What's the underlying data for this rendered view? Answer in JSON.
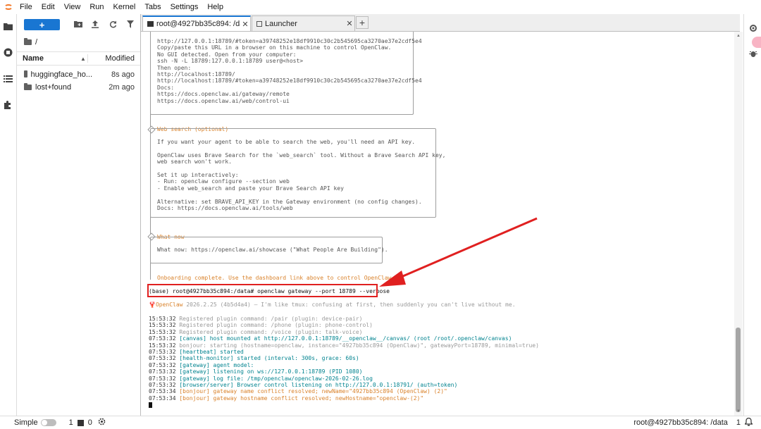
{
  "menu": [
    "File",
    "Edit",
    "View",
    "Run",
    "Kernel",
    "Tabs",
    "Settings",
    "Help"
  ],
  "filebrowser": {
    "new_label": "+",
    "breadcrumb": "/",
    "col_name": "Name",
    "col_modified": "Modified",
    "items": [
      {
        "name": "huggingface_ho...",
        "modified": "8s ago"
      },
      {
        "name": "lost+found",
        "modified": "2m ago"
      }
    ]
  },
  "tabs": {
    "terminal": "root@4927bb35c894: /dat",
    "launcher": "Launcher",
    "close": "✕",
    "add": "+"
  },
  "terminal": {
    "block1": [
      "http://127.0.0.1:18789/#token=a39748252e18df9910c30c2b545695ca3270ae37e2cdf5e4",
      "Copy/paste this URL in a browser on this machine to control OpenClaw.",
      "No GUI detected. Open from your computer:",
      "ssh -N -L 18789:127.0.0.1:18789 user@<host>",
      "Then open:",
      "http://localhost:18789/",
      "http://localhost:18789/#token=a39748252e18df9910c30c2b545695ca3270ae37e2cdf5e4",
      "Docs:",
      "https://docs.openclaw.ai/gateway/remote",
      "https://docs.openclaw.ai/web/control-ui"
    ],
    "websearch_title": "Web search (optional)",
    "websearch": [
      "If you want your agent to be able to search the web, you'll need an API key.",
      "",
      "OpenClaw uses Brave Search for the `web_search` tool. Without a Brave Search API key,",
      "web search won't work.",
      "",
      "Set it up interactively:",
      "- Run: openclaw configure --section web",
      "- Enable web_search and paste your Brave Search API key",
      "",
      "Alternative: set BRAVE_API_KEY in the Gateway environment (no config changes).",
      "Docs: https://docs.openclaw.ai/tools/web"
    ],
    "whatnow_title": "What now",
    "whatnow": "What now: https://openclaw.ai/showcase (\"What People Are Building\").",
    "onboarding": "Onboarding complete. Use the dashboard link above to control OpenClaw.",
    "command": "(base) root@4927bb35c894:/data# openclaw gateway --port 18789 --verbose",
    "banner_name": "OpenClaw",
    "banner_rest": " 2026.2.25 (4b5d4a4) — I'm like tmux: confusing at first, then suddenly you can't live without me.",
    "logs": [
      {
        "time": "15:53:32",
        "tag": "",
        "text": "Registered plugin command: /pair (plugin: device-pair)",
        "color": "grey"
      },
      {
        "time": "15:53:32",
        "tag": "",
        "text": "Registered plugin command: /phone (plugin: phone-control)",
        "color": "grey"
      },
      {
        "time": "15:53:32",
        "tag": "",
        "text": "Registered plugin command: /voice (plugin: talk-voice)",
        "color": "grey"
      },
      {
        "time": "07:53:32",
        "tag": "[canvas]",
        "text": "host mounted at http://127.0.0.1:18789/__openclaw__/canvas/ (root /root/.openclaw/canvas)",
        "color": "teal"
      },
      {
        "time": "15:53:32",
        "tag": "",
        "text": "bonjour: starting (hostname=openclaw, instance=\"4927bb35c894 (OpenClaw)\", gatewayPort=18789, minimal=true)",
        "color": "grey"
      },
      {
        "time": "07:53:32",
        "tag": "[heartbeat]",
        "text": "started",
        "color": "teal"
      },
      {
        "time": "07:53:32",
        "tag": "[health-monitor]",
        "text": "started (interval: 300s, grace: 60s)",
        "color": "teal"
      },
      {
        "time": "07:53:32",
        "tag": "[gateway]",
        "text": "agent model:",
        "color": "teal"
      },
      {
        "time": "07:53:32",
        "tag": "[gateway]",
        "text": "listening on ws://127.0.0.1:18789 (PID 1080)",
        "color": "teal"
      },
      {
        "time": "07:53:32",
        "tag": "[gateway]",
        "text": "log file: /tmp/openclaw/openclaw-2026-02-26.log",
        "color": "teal"
      },
      {
        "time": "07:53:32",
        "tag": "[browser/server]",
        "text": "Browser control listening on http://127.0.0.1:18791/ (auth=token)",
        "color": "teal"
      },
      {
        "time": "07:53:34",
        "tag": "[bonjour]",
        "text": "gateway name conflict resolved; newName=\"4927bb35c894 (OpenClaw) (2)\"",
        "color": "orange"
      },
      {
        "time": "07:53:34",
        "tag": "[bonjour]",
        "text": "gateway hostname conflict resolved; newHostname=\"openclaw-(2)\"",
        "color": "orange"
      }
    ]
  },
  "status": {
    "simple": "Simple",
    "count1": "1",
    "count2": "0",
    "terminal_name": "root@4927bb35c894: /data",
    "count3": "1"
  },
  "colors": {
    "accent": "#1976d2",
    "annotation": "#e02020",
    "log_orange": "#d9822b",
    "log_teal": "#00838f"
  }
}
